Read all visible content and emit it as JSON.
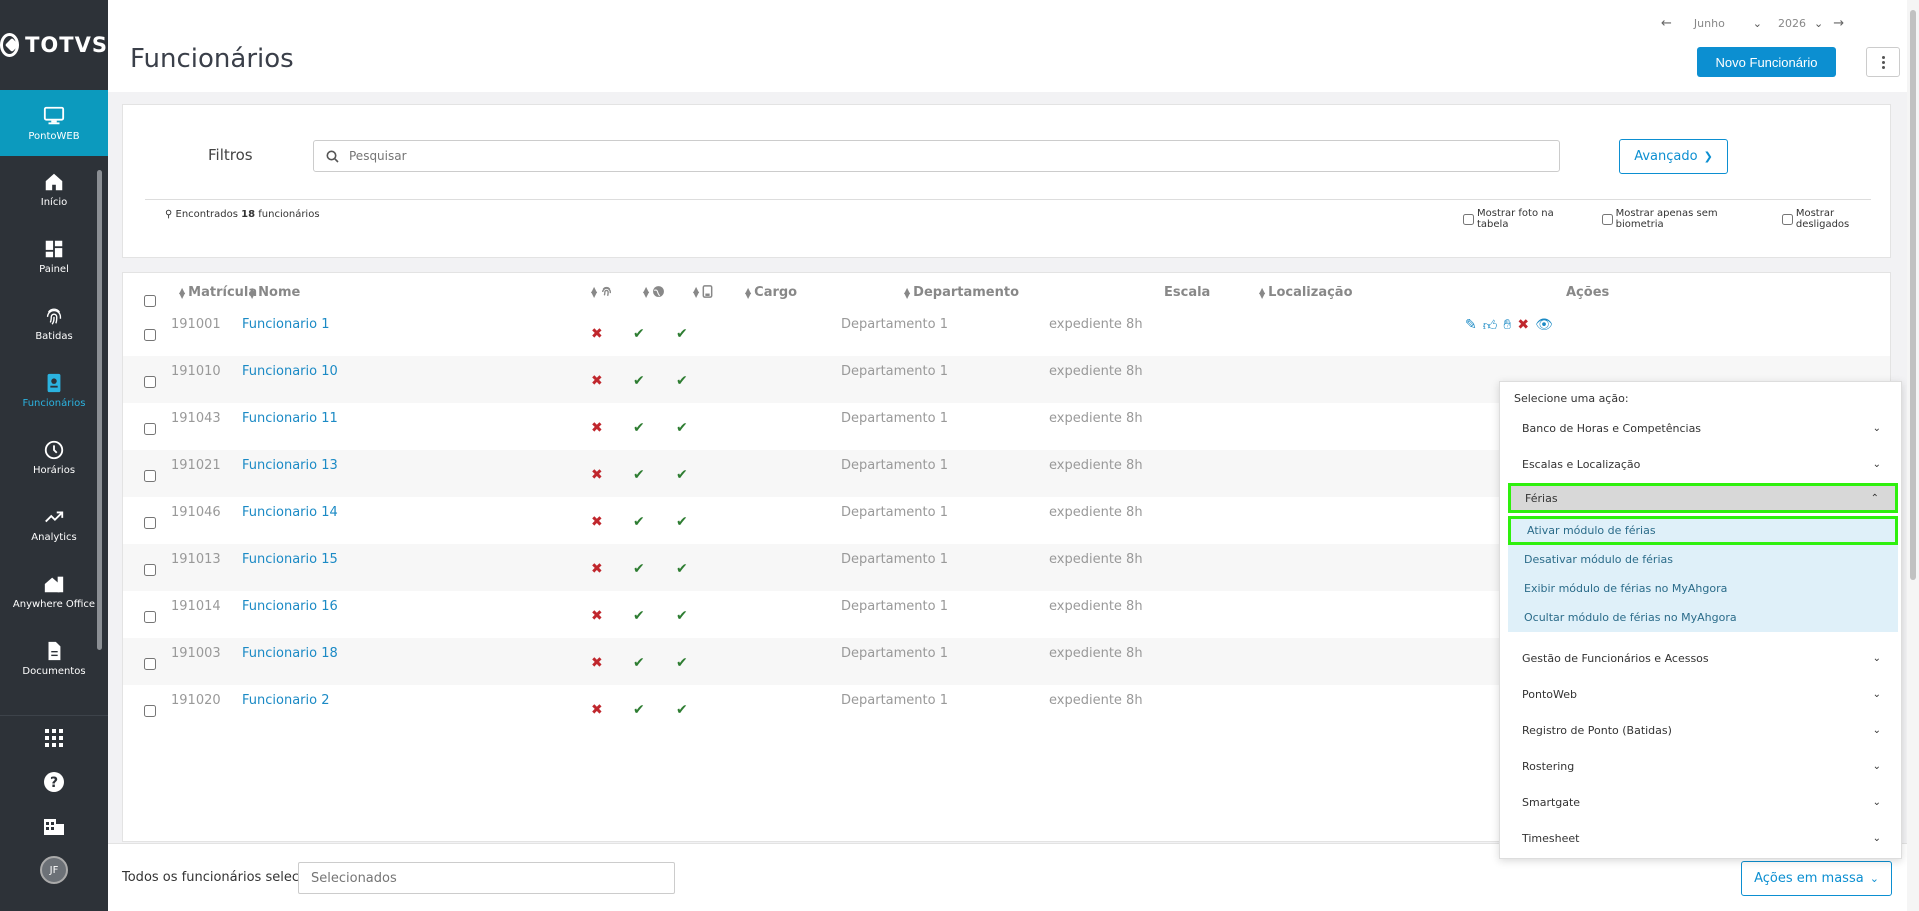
{
  "brand": {
    "name": "TOTVS"
  },
  "sidebar": {
    "items": [
      {
        "label": "PontoWEB",
        "icon": "monitor-icon"
      },
      {
        "label": "Início",
        "icon": "home-icon"
      },
      {
        "label": "Painel",
        "icon": "dashboard-icon"
      },
      {
        "label": "Batidas",
        "icon": "fingerprint-icon"
      },
      {
        "label": "Funcionários",
        "icon": "badge-icon"
      },
      {
        "label": "Horários",
        "icon": "clock-icon"
      },
      {
        "label": "Analytics",
        "icon": "trend-icon"
      },
      {
        "label": "Anywhere Office",
        "icon": "house-office-icon"
      },
      {
        "label": "Documentos",
        "icon": "document-icon"
      }
    ],
    "user_initials": "JF"
  },
  "header": {
    "title": "Funcionários",
    "month": "Junho",
    "year": "2026",
    "new_button": "Novo Funcionário"
  },
  "filters": {
    "label": "Filtros",
    "search_placeholder": "Pesquisar",
    "advanced": "Avançado",
    "found_prefix": "Encontrados",
    "found_count": "18",
    "found_suffix": "funcionários",
    "checkbox_photo": "Mostrar foto na tabela",
    "checkbox_biometry": "Mostrar apenas sem biometria",
    "checkbox_fired": "Mostrar desligados"
  },
  "table": {
    "headers": {
      "matricula": "Matrícula",
      "nome": "Nome",
      "cargo": "Cargo",
      "departamento": "Departamento",
      "escala": "Escala",
      "localizacao": "Localização",
      "acoes": "Ações"
    },
    "rows": [
      {
        "matricula": "191001",
        "nome": "Funcionario 1",
        "departamento": "Departamento 1",
        "escala": "expediente 8h"
      },
      {
        "matricula": "191010",
        "nome": "Funcionario 10",
        "departamento": "Departamento 1",
        "escala": "expediente 8h"
      },
      {
        "matricula": "191043",
        "nome": "Funcionario 11",
        "departamento": "Departamento 1",
        "escala": "expediente 8h"
      },
      {
        "matricula": "191021",
        "nome": "Funcionario 13",
        "departamento": "Departamento 1",
        "escala": "expediente 8h"
      },
      {
        "matricula": "191046",
        "nome": "Funcionario 14",
        "departamento": "Departamento 1",
        "escala": "expediente 8h"
      },
      {
        "matricula": "191013",
        "nome": "Funcionario 15",
        "departamento": "Departamento 1",
        "escala": "expediente 8h"
      },
      {
        "matricula": "191014",
        "nome": "Funcionario 16",
        "departamento": "Departamento 1",
        "escala": "expediente 8h"
      },
      {
        "matricula": "191003",
        "nome": "Funcionario 18",
        "departamento": "Departamento 1",
        "escala": "expediente 8h"
      },
      {
        "matricula": "191020",
        "nome": "Funcionario 2",
        "departamento": "Departamento 1",
        "escala": "expediente 8h"
      }
    ]
  },
  "footer": {
    "label": "Todos os funcionários selecionados",
    "input_placeholder": "Selecionados",
    "mass_actions": "Ações em massa"
  },
  "dropdown": {
    "title": "Selecione uma ação:",
    "groups_before": [
      "Banco de Horas e Competências",
      "Escalas e Localização"
    ],
    "open_group": "Férias",
    "sub_items": [
      "Ativar módulo de férias",
      "Desativar módulo de férias",
      "Exibir módulo de férias no MyAhgora",
      "Ocultar módulo de férias no MyAhgora"
    ],
    "groups_after": [
      "Gestão de Funcionários e Acessos",
      "PontoWeb",
      "Registro de Ponto (Batidas)",
      "Rostering",
      "Smartgate",
      "Timesheet"
    ]
  },
  "colors": {
    "accent": "#0c8fd1",
    "sidebar": "#2d3238",
    "highlight": "#2ef00d",
    "error": "#c0272d",
    "success": "#2e7d32"
  }
}
